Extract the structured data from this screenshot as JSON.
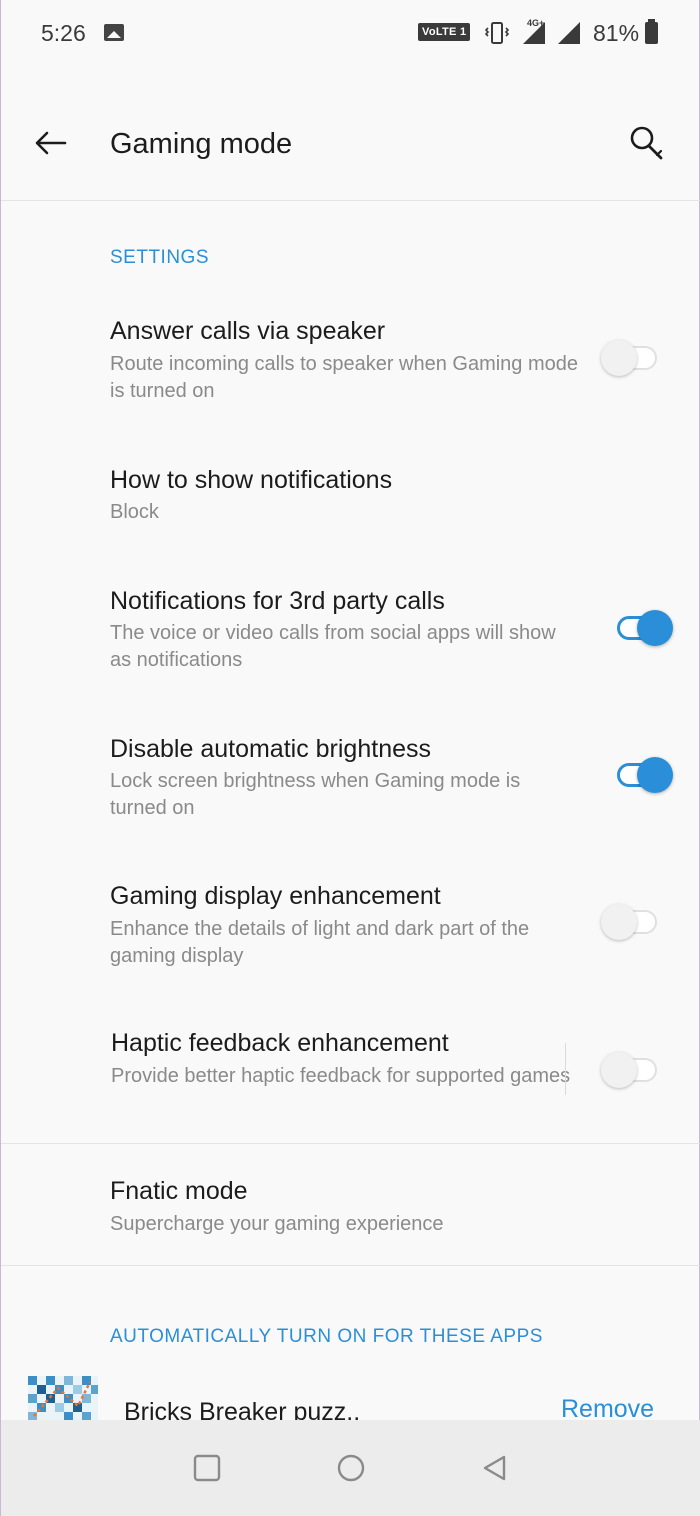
{
  "status_bar": {
    "time": "5:26",
    "volte_label": "VoLTE 1",
    "network_label": "4G+",
    "battery_percent": "81%"
  },
  "app_bar": {
    "title": "Gaming mode",
    "back_icon": "arrow-left-icon",
    "search_icon": "search-icon"
  },
  "settings_section": {
    "header": "SETTINGS",
    "items": [
      {
        "title": "Answer calls via speaker",
        "subtitle": "Route incoming calls to speaker when Gaming mode is turned on",
        "toggle": false
      },
      {
        "title": "How to show notifications",
        "subtitle": "Block"
      },
      {
        "title": "Notifications for 3rd party calls",
        "subtitle": "The voice or video calls from social apps will show as notifications",
        "toggle": true
      },
      {
        "title": "Disable automatic brightness",
        "subtitle": "Lock screen brightness when Gaming mode is turned on",
        "toggle": true
      },
      {
        "title": "Gaming display enhancement",
        "subtitle": "Enhance the details of light and dark part of the gaming display",
        "toggle": false
      },
      {
        "title": "Haptic feedback enhancement",
        "subtitle": "Provide better haptic feedback for supported games",
        "toggle": false
      },
      {
        "title": "Fnatic mode",
        "subtitle": "Supercharge your gaming experience"
      }
    ]
  },
  "apps_section": {
    "header": "AUTOMATICALLY TURN ON FOR THESE APPS",
    "apps": [
      {
        "name": "Bricks Breaker puzz..",
        "action": "Remove"
      }
    ]
  },
  "nav_bar": {
    "buttons": [
      "recents-icon",
      "home-icon",
      "back-triangle-icon"
    ]
  },
  "colors": {
    "accent": "#2a8fd8",
    "background": "#f9f9f9",
    "subtitle": "#8a8a8a",
    "navbar": "#ececec"
  }
}
